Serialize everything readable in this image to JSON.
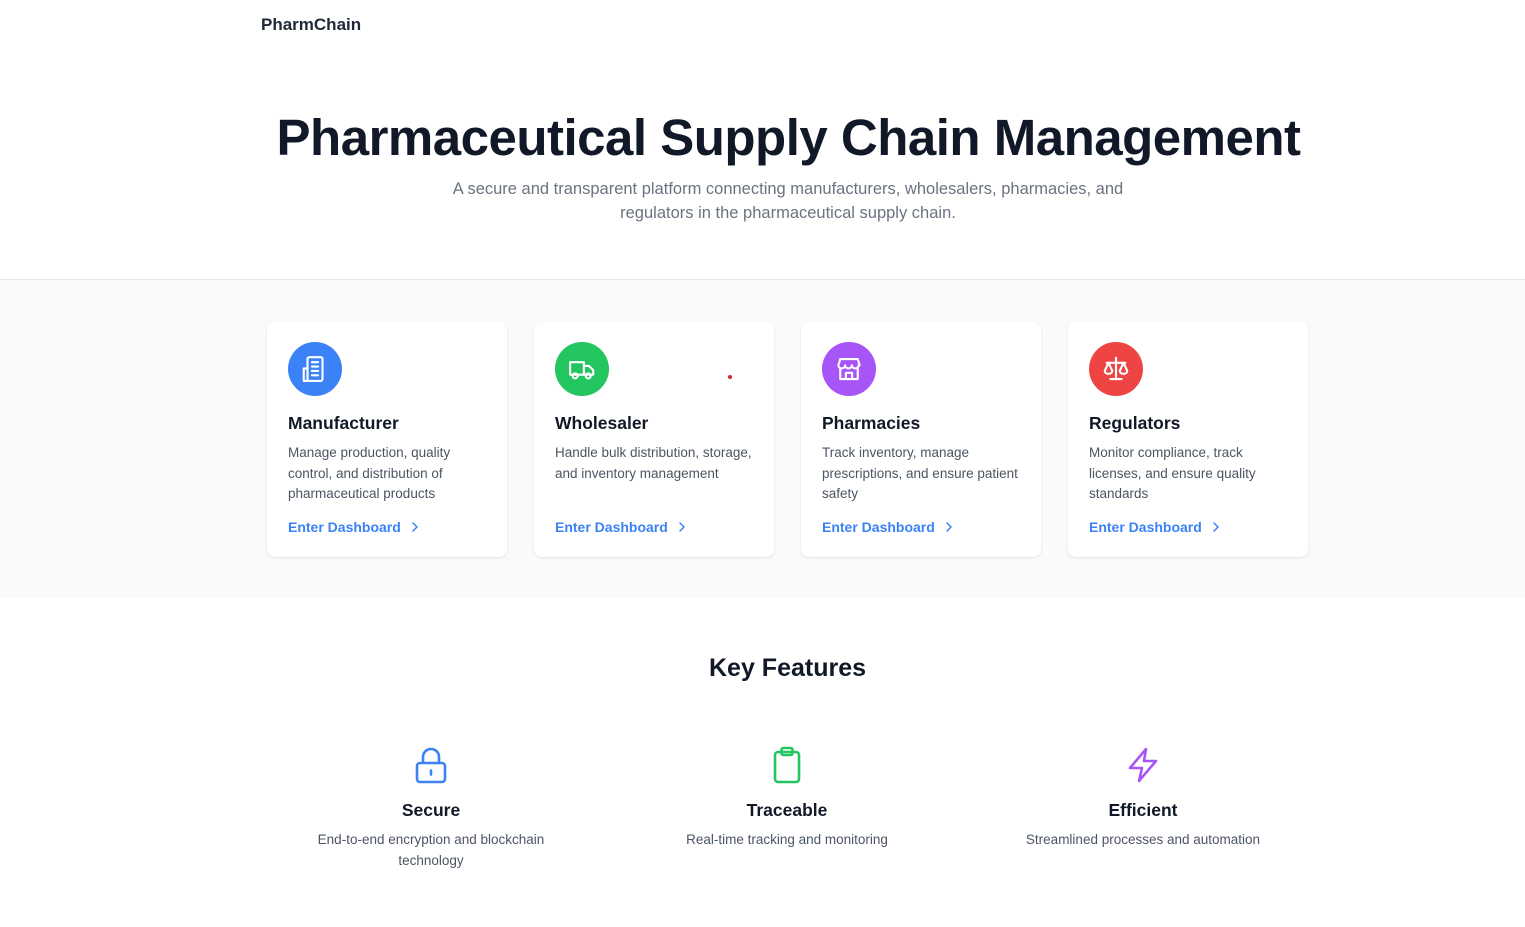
{
  "nav": {
    "brand": "PharmChain"
  },
  "hero": {
    "title": "Pharmaceutical Supply Chain Management",
    "subtitle": "A secure and transparent platform connecting manufacturers, wholesalers, pharmacies, and regulators in the pharmaceutical supply chain."
  },
  "roles": [
    {
      "name": "Manufacturer",
      "description": "Manage production, quality control, and distribution of pharmaceutical products",
      "link": "Enter Dashboard",
      "icon": "building-icon",
      "color": "#3b82f6"
    },
    {
      "name": "Wholesaler",
      "description": "Handle bulk distribution, storage, and inventory management",
      "link": "Enter Dashboard",
      "icon": "truck-icon",
      "color": "#22c55e"
    },
    {
      "name": "Pharmacies",
      "description": "Track inventory, manage prescriptions, and ensure patient safety",
      "link": "Enter Dashboard",
      "icon": "store-icon",
      "color": "#a855f7"
    },
    {
      "name": "Regulators",
      "description": "Monitor compliance, track licenses, and ensure quality standards",
      "link": "Enter Dashboard",
      "icon": "scale-icon",
      "color": "#ef4444"
    }
  ],
  "features": {
    "title": "Key Features",
    "items": [
      {
        "title": "Secure",
        "description": "End-to-end encryption and blockchain technology",
        "icon": "lock-icon",
        "color": "#3b82f6"
      },
      {
        "title": "Traceable",
        "description": "Real-time tracking and monitoring",
        "icon": "clipboard-icon",
        "color": "#22c55e"
      },
      {
        "title": "Efficient",
        "description": "Streamlined processes and automation",
        "icon": "lightning-icon",
        "color": "#a855f7"
      }
    ]
  }
}
